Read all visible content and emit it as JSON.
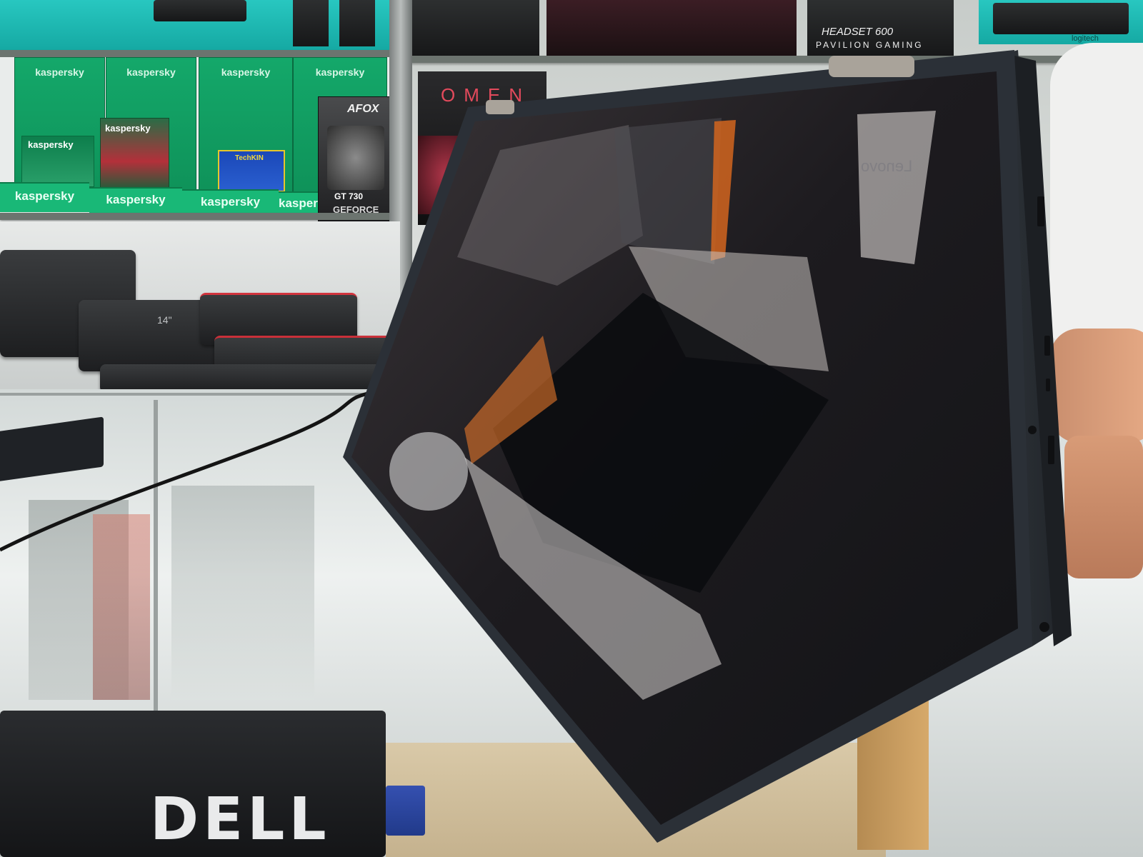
{
  "scene": {
    "description_labels": {
      "kaspersky_box_brand": "kaspersky",
      "kaspersky_top_brand": "kaspersky",
      "afox_brand": "AFOX",
      "gpu_model": "GT 730",
      "gpu_series": "GEFORCE",
      "omen_brand": "OMEN",
      "headset_model": "HEADSET 600",
      "headset_line": "PAVILION GAMING",
      "logitech_brand": "logitech",
      "techkin_brand": "TechKIN",
      "dell_brand": "DELL",
      "bag_size": "14\"",
      "lenovo_reflection": "Lenovo"
    }
  },
  "colors": {
    "kaspersky_green": "#14a86a",
    "laptop_body": "#2b3037",
    "screen_reflection": "#1a1c22",
    "omen_red": "#e34a5c"
  }
}
